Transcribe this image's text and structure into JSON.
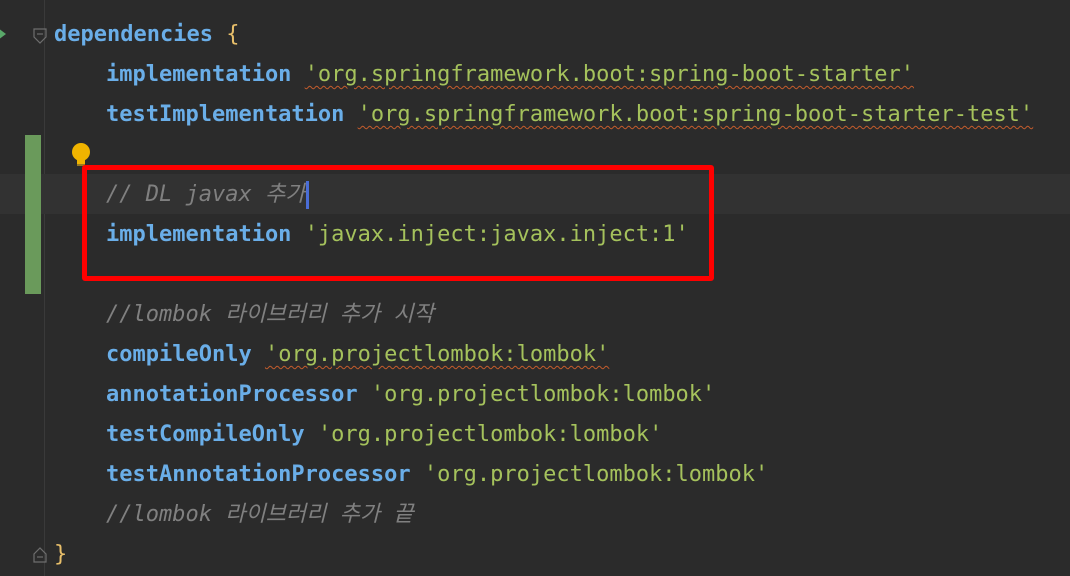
{
  "code_lines": {
    "l1_kw": "dependencies",
    "l1_brace": "{",
    "l2_kw": "implementation",
    "l2_str": "'org.springframework.boot:spring-boot-starter'",
    "l3_kw": "testImplementation",
    "l3_str": "'org.springframework.boot:spring-boot-starter-test'",
    "l5_cmt": "// DL javax 추가",
    "l6_kw": "implementation",
    "l6_str": "'javax.inject:javax.inject:1'",
    "l8_cmt": "//lombok 라이브러리 추가 시작",
    "l9_kw": "compileOnly",
    "l9_str": "'org.projectlombok:lombok'",
    "l10_kw": "annotationProcessor",
    "l10_str": "'org.projectlombok:lombok'",
    "l11_kw": "testCompileOnly",
    "l11_str": "'org.projectlombok:lombok'",
    "l12_kw": "testAnnotationProcessor",
    "l12_str": "'org.projectlombok:lombok'",
    "l13_cmt": "//lombok 라이브러리 추가 끝",
    "l14_brace": "}"
  },
  "icons": {
    "run": "run-gutter-icon",
    "fold_open": "fold-open-icon",
    "fold_close": "fold-close-icon",
    "bulb": "intention-bulb-icon"
  },
  "colors": {
    "background": "#2b2b2b",
    "keyword": "#6aaee8",
    "string": "#a5c25c",
    "comment": "#808080",
    "brace": "#e8bf6a",
    "highlight": "#ff0000",
    "vcs_added": "#6a9a5b"
  }
}
